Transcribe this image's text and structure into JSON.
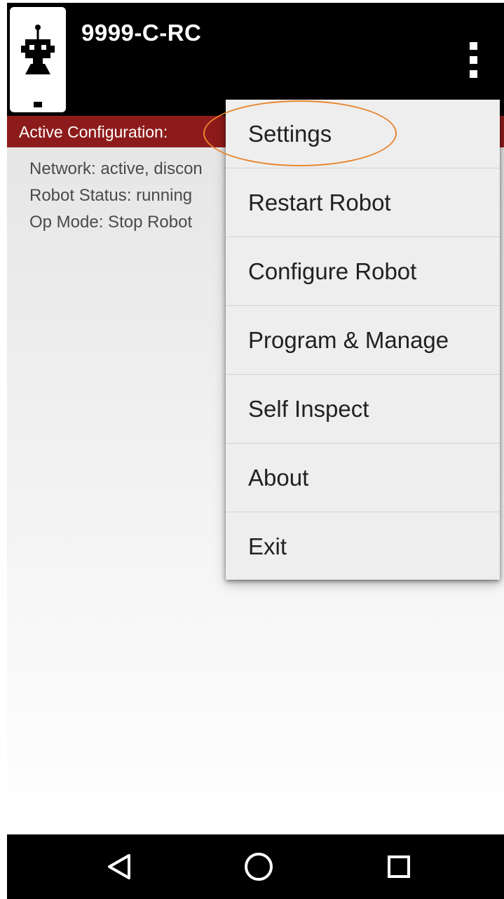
{
  "app_bar": {
    "title": "9999-C-RC",
    "app_icon": "robot-controller-icon",
    "overflow_icon": "more-vert-icon"
  },
  "config_bar": {
    "label": "Active Configuration:"
  },
  "status": {
    "network": "Network: active, discon",
    "robot_status": "Robot Status: running",
    "op_mode": "Op Mode: Stop Robot"
  },
  "menu": {
    "items": [
      {
        "label": "Settings"
      },
      {
        "label": "Restart Robot"
      },
      {
        "label": "Configure Robot"
      },
      {
        "label": "Program & Manage"
      },
      {
        "label": "Self Inspect"
      },
      {
        "label": "About"
      },
      {
        "label": "Exit"
      }
    ],
    "highlighted": "Settings"
  },
  "nav_bar": {
    "back_icon": "back-triangle-icon",
    "home_icon": "home-circle-icon",
    "recents_icon": "recents-square-icon"
  },
  "colors": {
    "app_bar": "#000000",
    "config_bar": "#8e1b1b",
    "menu_background": "#eeeeee",
    "highlight": "#e8852e",
    "nav_bar": "#000000"
  }
}
